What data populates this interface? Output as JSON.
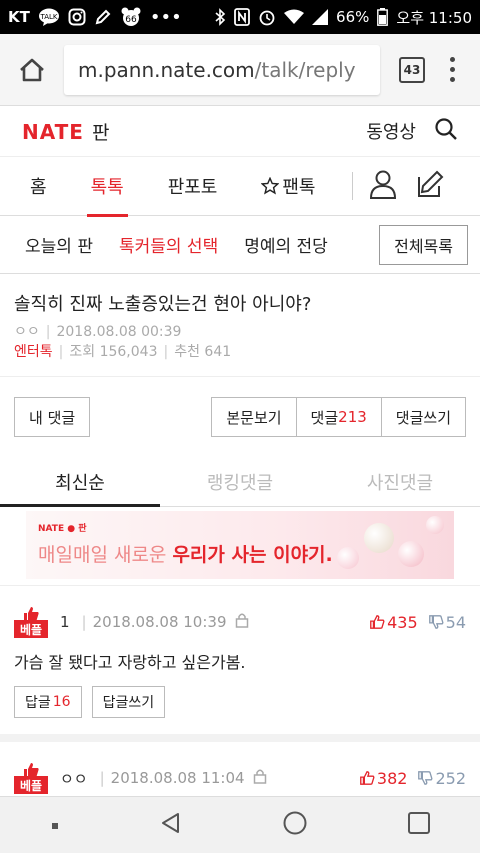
{
  "status_bar": {
    "carrier": "KT",
    "battery": "66%",
    "time": "오후 11:50",
    "badge_num": "66"
  },
  "browser": {
    "url_host": "m.pann.nate.com",
    "url_path": "/talk/reply",
    "tab_count": "43"
  },
  "header": {
    "logo_nate": "NATE",
    "logo_pan": "판",
    "video_label": "동영상"
  },
  "main_nav": {
    "items": [
      "홈",
      "톡톡",
      "판포토",
      "팬톡"
    ]
  },
  "sub_nav": {
    "items": [
      "오늘의 판",
      "톡커들의 선택",
      "명예의 전당"
    ],
    "all_label": "전체목록"
  },
  "post": {
    "title": "솔직히 진짜 노출증있는건 현아 아니야?",
    "author": "ㅇㅇ",
    "datetime": "2018.08.08 00:39",
    "category": "엔터톡",
    "views_label": "조회",
    "views": "156,043",
    "recommend_label": "추천",
    "recommend": "641"
  },
  "actions": {
    "my_comments": "내 댓글",
    "view_body": "본문보기",
    "comments_label": "댓글",
    "comments_count": "213",
    "write_comment": "댓글쓰기"
  },
  "sort_tabs": [
    "최신순",
    "랭킹댓글",
    "사진댓글"
  ],
  "banner": {
    "logo": "NATE ● 판",
    "text_plain": "매일매일 새로운 ",
    "text_bold": "우리가 사는 이야기."
  },
  "comments": [
    {
      "badge": "베플",
      "author": "1",
      "datetime": "2018.08.08 10:39",
      "up": "435",
      "down": "54",
      "body": "가슴 잘 됐다고 자랑하고 싶은가봄.",
      "reply_label": "답글",
      "reply_count": "16",
      "write_reply": "답글쓰기"
    },
    {
      "badge": "베플",
      "author": "ㅇㅇ",
      "datetime": "2018.08.08 11:04",
      "up": "382",
      "down": "252",
      "body": "",
      "reply_label": "",
      "reply_count": "",
      "write_reply": ""
    }
  ],
  "colors": {
    "brand_red": "#e4252c",
    "down_gray": "#8a9bb0"
  }
}
